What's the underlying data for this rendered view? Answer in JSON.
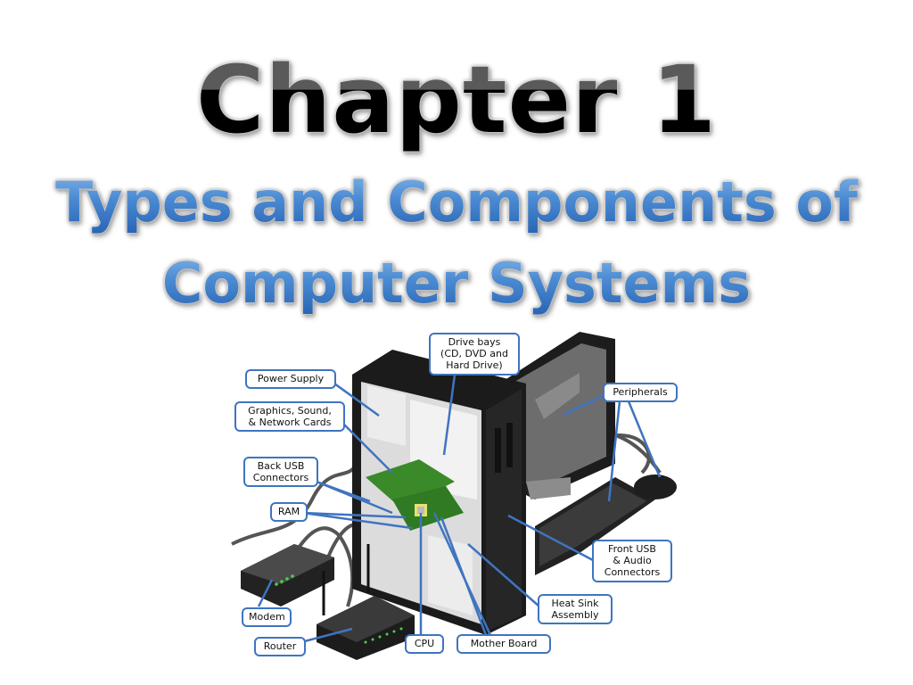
{
  "title": {
    "chapter": "Chapter 1",
    "subtitle_line1": "Types and Components of",
    "subtitle_line2": "Computer Systems"
  },
  "diagram": {
    "description": "Illustration of an open computer tower with monitor, keyboard, mouse, modem and router, with callout labels",
    "labels": [
      {
        "id": "power-supply",
        "text": "Power Supply"
      },
      {
        "id": "graphics-sound-network-cards",
        "text": "Graphics, Sound,\n& Network Cards"
      },
      {
        "id": "back-usb-connectors",
        "text": "Back USB\nConnectors"
      },
      {
        "id": "ram",
        "text": "RAM"
      },
      {
        "id": "modem",
        "text": "Modem"
      },
      {
        "id": "router",
        "text": "Router"
      },
      {
        "id": "cpu",
        "text": "CPU"
      },
      {
        "id": "mother-board",
        "text": "Mother Board"
      },
      {
        "id": "heat-sink-assembly",
        "text": "Heat Sink\nAssembly"
      },
      {
        "id": "front-usb-audio-connectors",
        "text": "Front USB\n& Audio\nConnectors"
      },
      {
        "id": "peripherals",
        "text": "Peripherals"
      },
      {
        "id": "drive-bays",
        "text": "Drive bays\n(CD, DVD and\nHard Drive)"
      }
    ],
    "colors": {
      "callout_border": "#3f74c0",
      "case": "#1e1e1e",
      "board": "#3a8a2a",
      "panel": "#e4e4e4"
    }
  }
}
